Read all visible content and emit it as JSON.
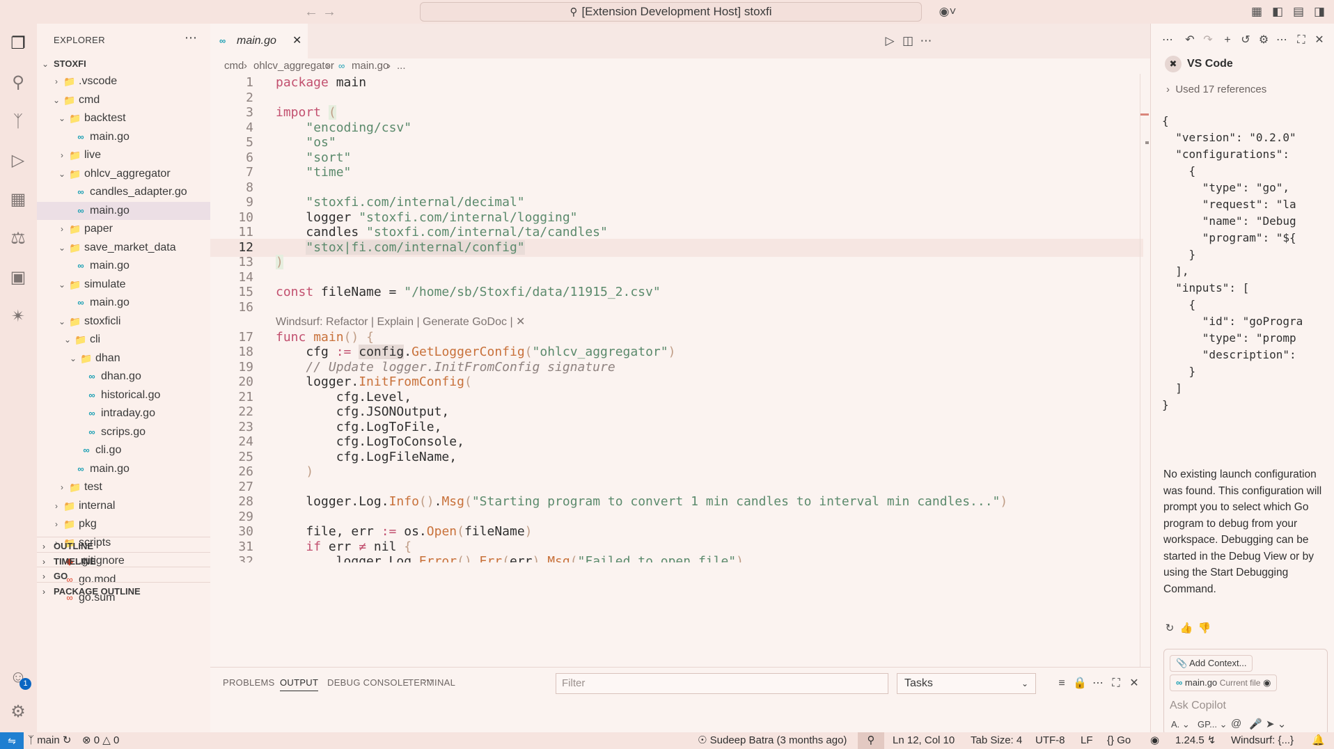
{
  "titlebar": {
    "command_center": "[Extension Development Host] stoxfi",
    "back_icon": "arrow-left-icon",
    "forward_icon": "arrow-right-icon"
  },
  "explorer": {
    "title": "EXPLORER",
    "root": "STOXFI",
    "tree": [
      {
        "label": ".vscode",
        "depth": 1,
        "kind": "folder-special",
        "expanded": false
      },
      {
        "label": "cmd",
        "depth": 1,
        "kind": "folder",
        "expanded": true
      },
      {
        "label": "backtest",
        "depth": 2,
        "kind": "folder",
        "expanded": true
      },
      {
        "label": "main.go",
        "depth": 3,
        "kind": "go"
      },
      {
        "label": "live",
        "depth": 2,
        "kind": "folder",
        "expanded": false
      },
      {
        "label": "ohlcv_aggregator",
        "depth": 2,
        "kind": "folder",
        "expanded": true
      },
      {
        "label": "candles_adapter.go",
        "depth": 3,
        "kind": "go"
      },
      {
        "label": "main.go",
        "depth": 3,
        "kind": "go",
        "selected": true
      },
      {
        "label": "paper",
        "depth": 2,
        "kind": "folder",
        "expanded": false
      },
      {
        "label": "save_market_data",
        "depth": 2,
        "kind": "folder",
        "expanded": true
      },
      {
        "label": "main.go",
        "depth": 3,
        "kind": "go"
      },
      {
        "label": "simulate",
        "depth": 2,
        "kind": "folder",
        "expanded": true
      },
      {
        "label": "main.go",
        "depth": 3,
        "kind": "go"
      },
      {
        "label": "stoxficli",
        "depth": 2,
        "kind": "folder",
        "expanded": true
      },
      {
        "label": "cli",
        "depth": 3,
        "kind": "folder-special",
        "expanded": true
      },
      {
        "label": "dhan",
        "depth": 4,
        "kind": "folder",
        "expanded": true
      },
      {
        "label": "dhan.go",
        "depth": 5,
        "kind": "go"
      },
      {
        "label": "historical.go",
        "depth": 5,
        "kind": "go"
      },
      {
        "label": "intraday.go",
        "depth": 5,
        "kind": "go"
      },
      {
        "label": "scrips.go",
        "depth": 5,
        "kind": "go"
      },
      {
        "label": "cli.go",
        "depth": 4,
        "kind": "go"
      },
      {
        "label": "main.go",
        "depth": 3,
        "kind": "go"
      },
      {
        "label": "test",
        "depth": 2,
        "kind": "folder-test",
        "expanded": false
      },
      {
        "label": "internal",
        "depth": 1,
        "kind": "folder",
        "expanded": false
      },
      {
        "label": "pkg",
        "depth": 1,
        "kind": "folder",
        "expanded": false
      },
      {
        "label": "scripts",
        "depth": 1,
        "kind": "folder-special",
        "expanded": false
      },
      {
        "label": ".gitignore",
        "depth": 1,
        "kind": "git"
      },
      {
        "label": "go.mod",
        "depth": 1,
        "kind": "gomod"
      },
      {
        "label": "go.sum",
        "depth": 1,
        "kind": "gomod"
      }
    ],
    "sections": [
      "OUTLINE",
      "TIMELINE",
      "GO",
      "PACKAGE OUTLINE"
    ]
  },
  "editor": {
    "tab_label": "main.go",
    "breadcrumb": [
      "cmd",
      "ohlcv_aggregator",
      "main.go",
      "..."
    ],
    "codelens": "Windsurf: Refactor | Explain | Generate GoDoc | ✕",
    "current_line": 12
  },
  "panel": {
    "tabs": [
      "PROBLEMS",
      "OUTPUT",
      "DEBUG CONSOLE",
      "TERMINAL"
    ],
    "active_tab": "OUTPUT",
    "filter_placeholder": "Filter",
    "task_select": "Tasks"
  },
  "chat": {
    "header": "VS Code",
    "used_refs": "Used 17 references",
    "json_lines": [
      "{",
      "  \"version\": \"0.2.0\"",
      "  \"configurations\":",
      "    {",
      "      \"type\": \"go\",",
      "      \"request\": \"la",
      "      \"name\": \"Debug",
      "      \"program\": \"${",
      "    }",
      "  ],",
      "  \"inputs\": [",
      "    {",
      "      \"id\": \"goProgra",
      "      \"type\": \"promp",
      "      \"description\":",
      "    }",
      "  ]",
      "}"
    ],
    "message": "No existing launch configuration was found. This configuration will prompt you to select which Go program to debug from your workspace. Debugging can be started in the Debug View or by using the Start Debugging Command.",
    "add_context": "Add Context...",
    "current_file": "main.go",
    "current_file_sub": "Current file",
    "ask_placeholder": "Ask Copilot",
    "mode_label": "A.",
    "model_label": "GP..."
  },
  "statusbar": {
    "branch": "main",
    "errors": "0",
    "warnings": "0",
    "blame": "Sudeep Batra (3 months ago)",
    "position": "Ln 12, Col 10",
    "tab_size": "Tab Size: 4",
    "encoding": "UTF-8",
    "eol": "LF",
    "language": "Go",
    "go_version": "1.24.5",
    "windsurf": "Windsurf: {...}"
  },
  "colors": {
    "accent": "#1f7fd1",
    "keyword": "#c2506f",
    "string": "#5b8a6c",
    "function": "#c8713a"
  }
}
